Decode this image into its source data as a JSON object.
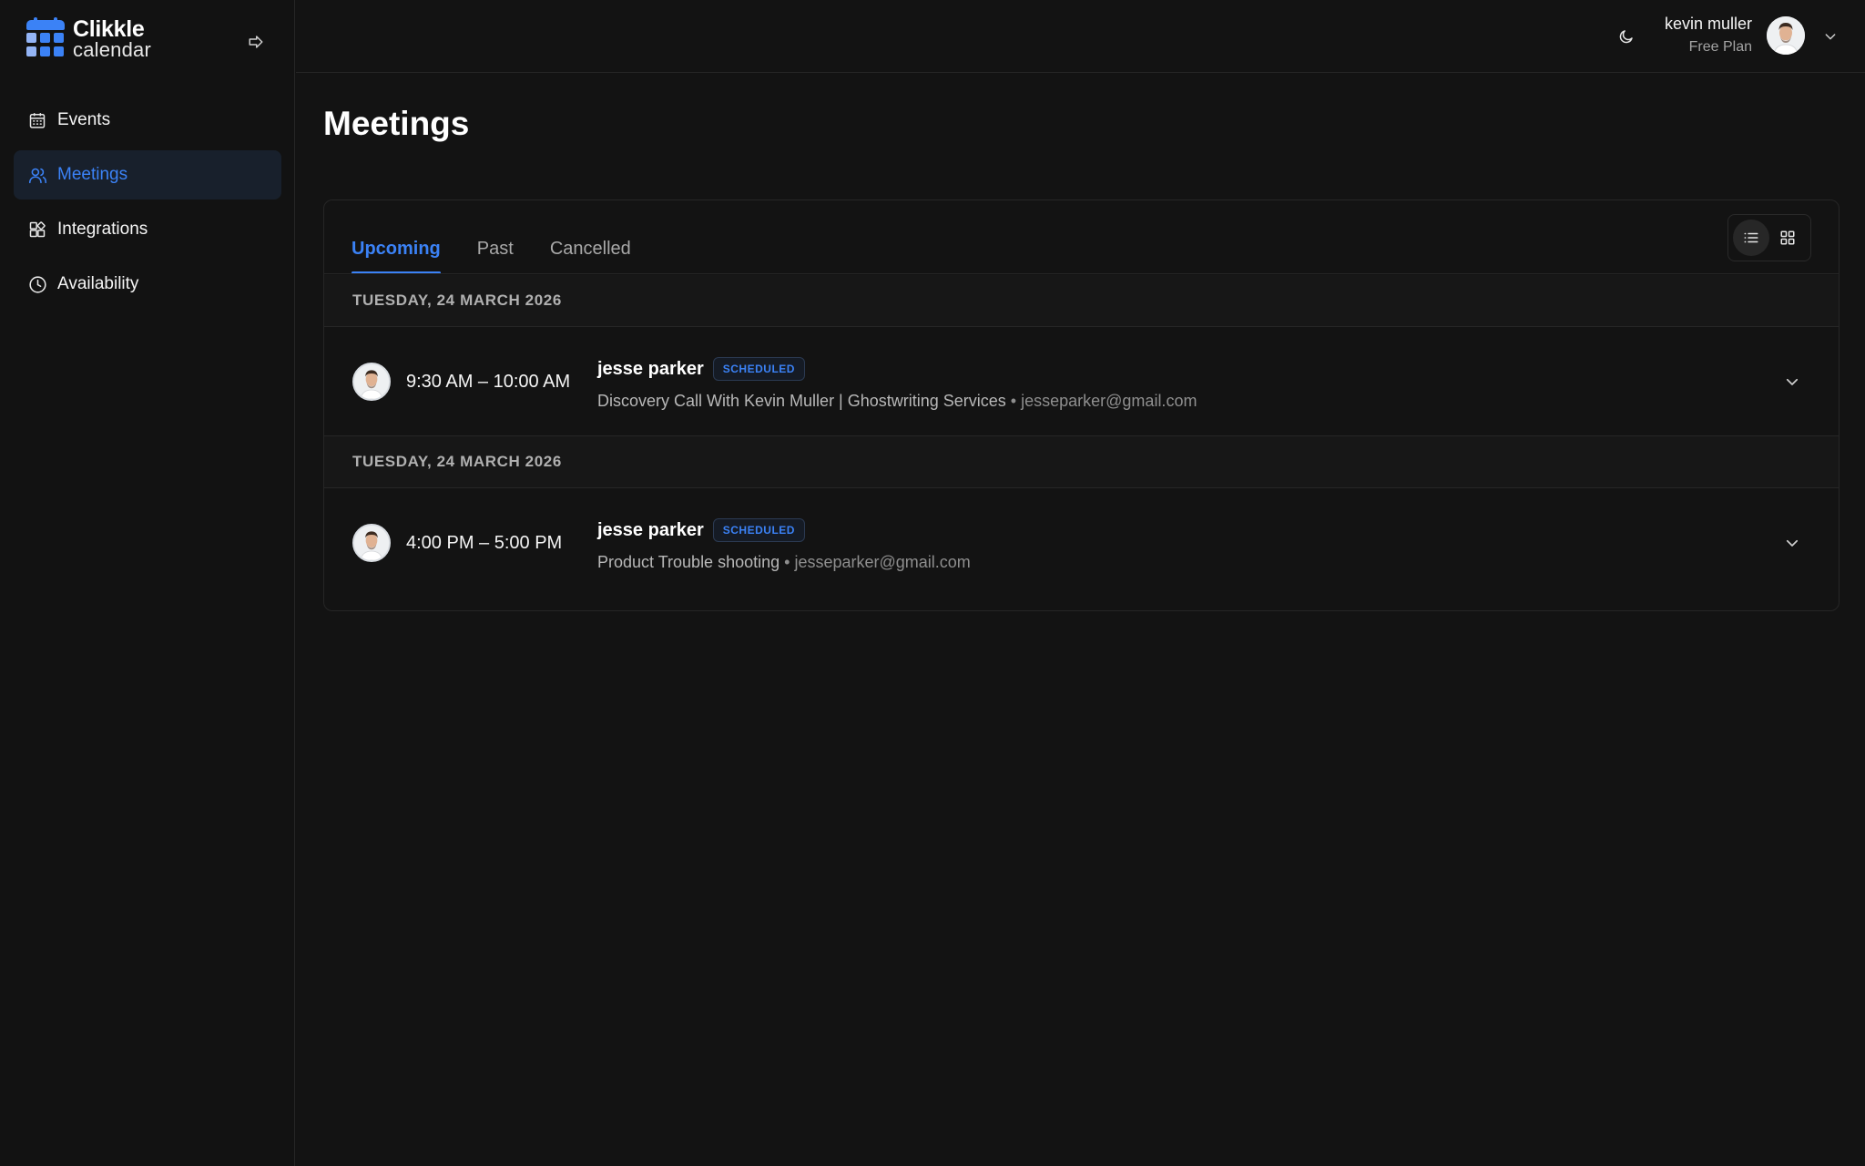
{
  "brand": {
    "name_line1": "Clikkle",
    "name_line2": "calendar",
    "colors": {
      "primary": "#3b82f6",
      "light": "#93b4f5"
    }
  },
  "sidebar": {
    "items": [
      {
        "label": "Events",
        "icon": "calendar-icon",
        "active": false
      },
      {
        "label": "Meetings",
        "icon": "users-icon",
        "active": true
      },
      {
        "label": "Integrations",
        "icon": "integrations-icon",
        "active": false
      },
      {
        "label": "Availability",
        "icon": "clock-icon",
        "active": false
      }
    ]
  },
  "header": {
    "user_name": "kevin muller",
    "user_plan": "Free Plan"
  },
  "page": {
    "title": "Meetings"
  },
  "tabs": [
    {
      "label": "Upcoming",
      "active": true
    },
    {
      "label": "Past",
      "active": false
    },
    {
      "label": "Cancelled",
      "active": false
    }
  ],
  "view_toggle": {
    "active": "list"
  },
  "meetings": [
    {
      "date": "TUESDAY, 24 MARCH 2026",
      "time": "9:30 AM – 10:00 AM",
      "name": "jesse parker",
      "status": "SCHEDULED",
      "event": "Discovery Call With Kevin Muller | Ghostwriting Services",
      "separator": " • ",
      "email": "jesseparker@gmail.com"
    },
    {
      "date": "TUESDAY, 24 MARCH 2026",
      "time": "4:00 PM – 5:00 PM",
      "name": "jesse parker",
      "status": "SCHEDULED",
      "event": "Product Trouble shooting",
      "separator": " • ",
      "email": "jesseparker@gmail.com"
    }
  ]
}
